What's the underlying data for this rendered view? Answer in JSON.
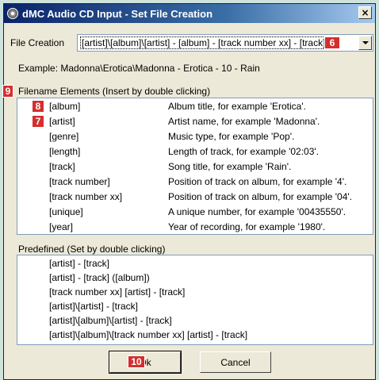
{
  "window": {
    "title": "dMC Audio CD Input - Set File Creation",
    "close_glyph": "×"
  },
  "file_creation": {
    "label": "File Creation",
    "value": "[artist]\\[album]\\[artist] - [album] - [track number xx] - [track]"
  },
  "example_text": "Example: Madonna\\Erotica\\Madonna - Erotica - 10 - Rain",
  "filename_elements": {
    "header": "Filename Elements (Insert by double clicking)",
    "items": [
      {
        "tag": "[album]",
        "desc": "Album title, for example 'Erotica'."
      },
      {
        "tag": "[artist]",
        "desc": "Artist name, for example 'Madonna'."
      },
      {
        "tag": "[genre]",
        "desc": "Music type, for example 'Pop'."
      },
      {
        "tag": "[length]",
        "desc": "Length of track, for example '02:03'."
      },
      {
        "tag": "[track]",
        "desc": "Song title, for example 'Rain'."
      },
      {
        "tag": "[track number]",
        "desc": "Position of track on album, for example '4'."
      },
      {
        "tag": "[track number xx]",
        "desc": "Position of track on album, for example '04'."
      },
      {
        "tag": "[unique]",
        "desc": "A unique number, for example '00435550'."
      },
      {
        "tag": "[year]",
        "desc": "Year of recording, for example '1980'."
      }
    ]
  },
  "predefined": {
    "header": "Predefined (Set by double clicking)",
    "items": [
      "[artist] - [track]",
      "[artist] - [track] ([album])",
      "[track number xx] [artist] - [track]",
      "[artist]\\[artist] - [track]",
      "[artist]\\[album]\\[artist] - [track]",
      "[artist]\\[album]\\[track number xx] [artist] - [track]"
    ]
  },
  "buttons": {
    "ok": "Ok",
    "cancel": "Cancel"
  },
  "badges": {
    "b6": "6",
    "b7": "7",
    "b8": "8",
    "b9": "9",
    "b10": "10"
  },
  "colors": {
    "badge": "#d42e2e",
    "title_bar": "#0a246a",
    "dialog_bg": "#ece9d8"
  },
  "icons": {
    "app": "cd-audio-icon",
    "dropdown": "chevron-down-icon",
    "close": "close-icon"
  }
}
